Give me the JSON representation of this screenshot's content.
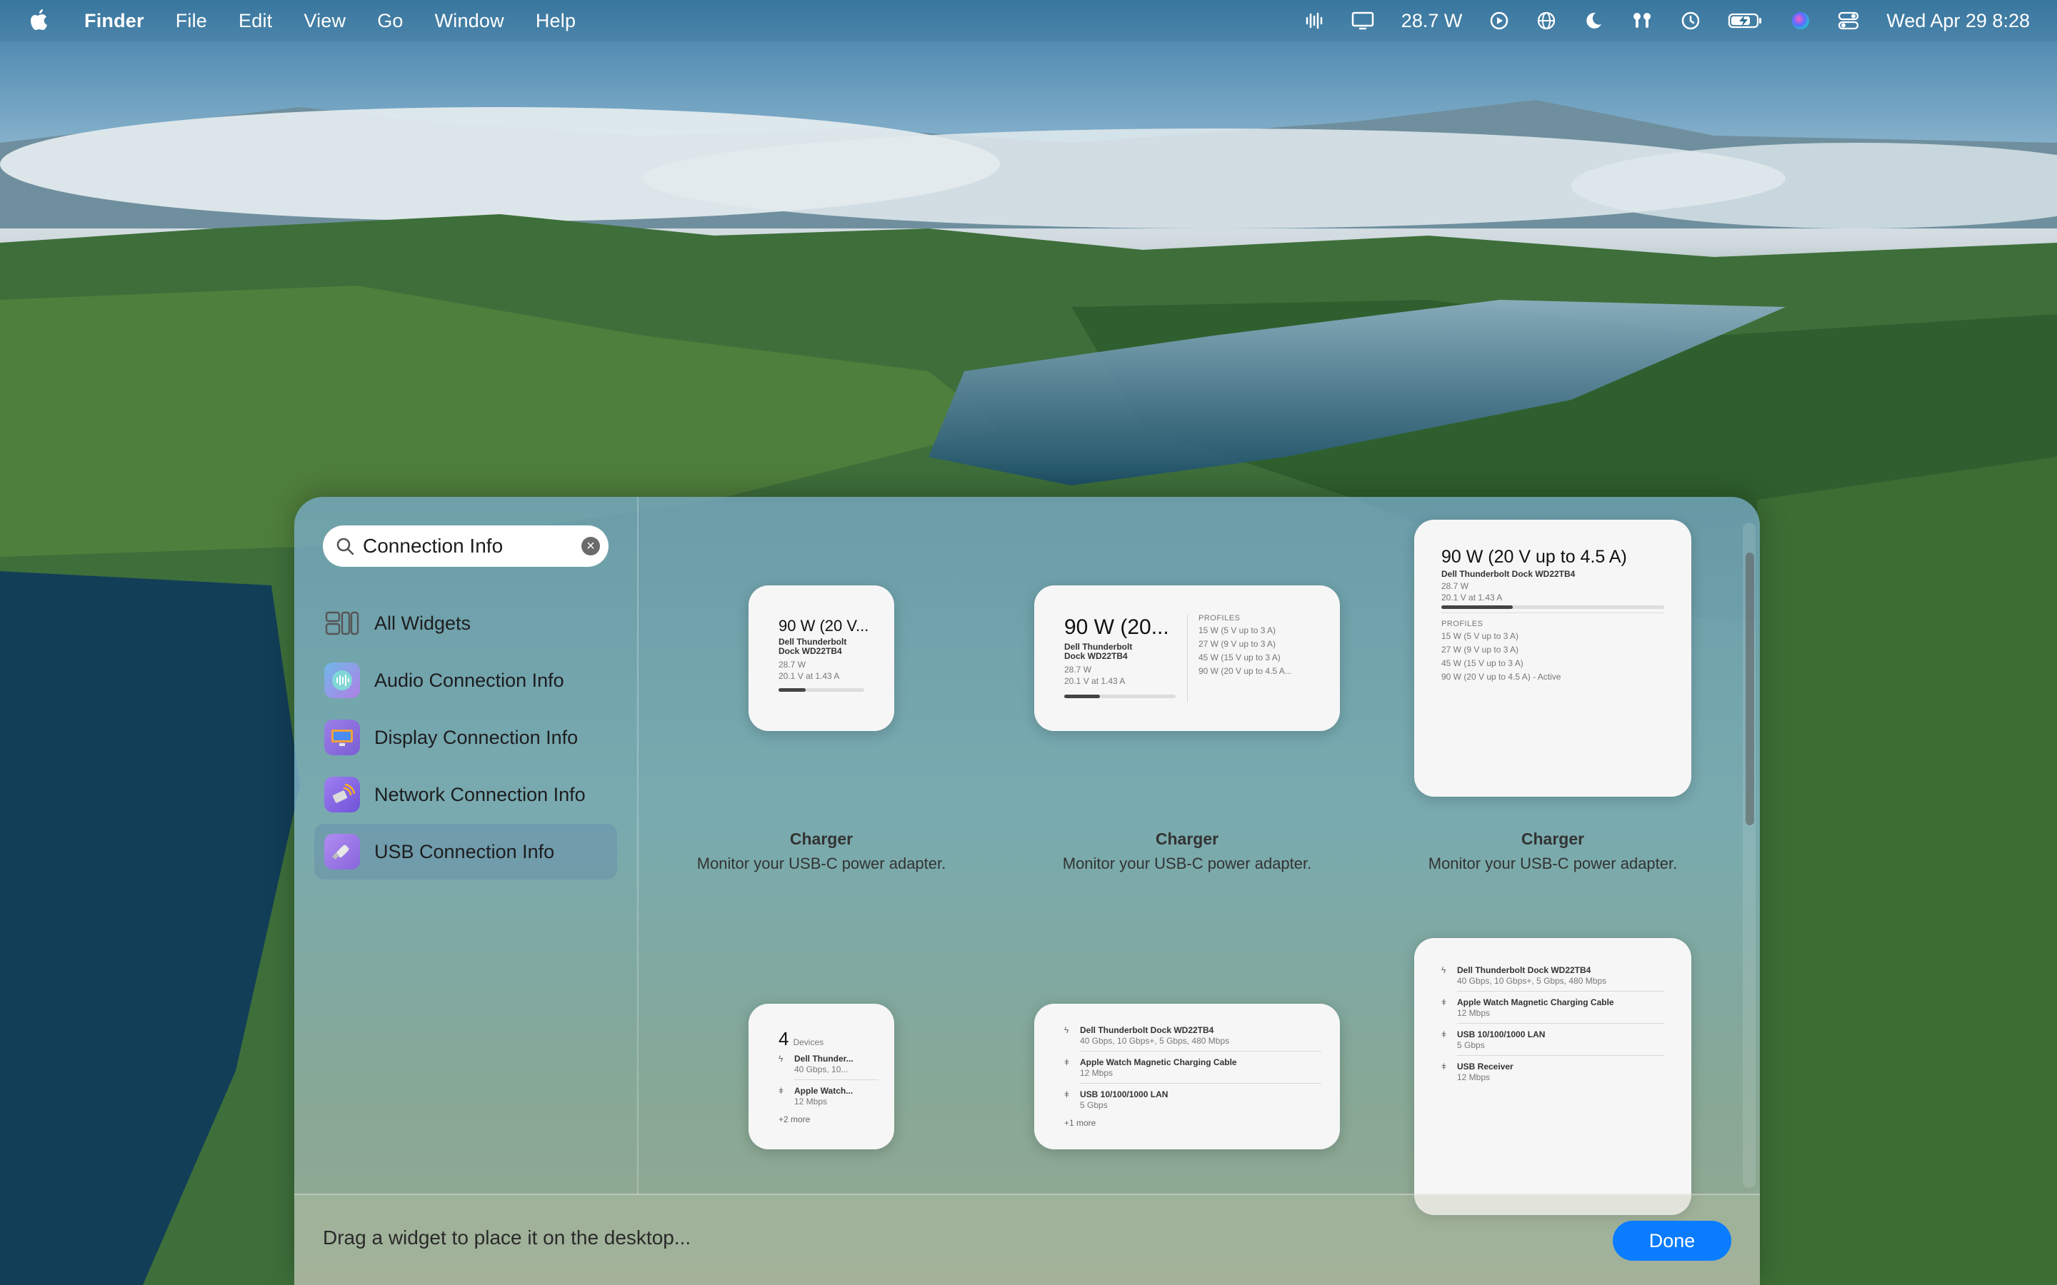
{
  "menubar": {
    "app_name": "Finder",
    "menus": [
      "File",
      "Edit",
      "View",
      "Go",
      "Window",
      "Help"
    ],
    "status": {
      "power_reading": "28.7 W",
      "datetime": "Wed Apr 29  8:28"
    }
  },
  "gallery": {
    "search": {
      "value": "Connection Info"
    },
    "sidebar": [
      {
        "label": "All Widgets",
        "icon": "widgets-grid-icon",
        "selected": false
      },
      {
        "label": "Audio Connection Info",
        "icon": "audio-app-icon",
        "selected": false
      },
      {
        "label": "Display Connection Info",
        "icon": "display-app-icon",
        "selected": false
      },
      {
        "label": "Network Connection Info",
        "icon": "network-app-icon",
        "selected": false
      },
      {
        "label": "USB Connection Info",
        "icon": "usb-app-icon",
        "selected": true
      }
    ],
    "charger": {
      "title": "90 W (20 V up to 4.5 A)",
      "title_small": "90 W (20 V...",
      "title_medium": "90 W (20...",
      "device": "Dell Thunderbolt Dock WD22TB4",
      "device_line1": "Dell Thunderbolt",
      "device_line2": "Dock WD22TB4",
      "watts": "28.7 W",
      "volts": "20.1 V at 1.43 A",
      "usage_fraction": 0.32,
      "profiles_heading": "PROFILES",
      "profiles": [
        "15 W (5 V up to 3 A)",
        "27 W (9 V up to 3 A)",
        "45 W (15 V up to 3 A)"
      ],
      "profile_last_medium": "90 W (20 V up to 4.5 A...",
      "profile_last_large": "90 W (20 V up to 4.5 A) - Active"
    },
    "captions": {
      "title": "Charger",
      "description": "Monitor your USB-C power adapter."
    },
    "devices": {
      "count": "4",
      "count_label": "Devices",
      "small": [
        {
          "name": "Dell Thunder...",
          "speed": "40 Gbps, 10..."
        },
        {
          "name": "Apple Watch...",
          "speed": "12 Mbps"
        }
      ],
      "small_more": "+2 more",
      "list": [
        {
          "name": "Dell Thunderbolt Dock WD22TB4",
          "speed": "40 Gbps, 10 Gbps+, 5 Gbps, 480 Mbps"
        },
        {
          "name": "Apple Watch Magnetic Charging Cable",
          "speed": "12 Mbps"
        },
        {
          "name": "USB 10/100/1000 LAN",
          "speed": "5 Gbps"
        },
        {
          "name": "USB Receiver",
          "speed": "12 Mbps"
        }
      ],
      "medium_more": "+1 more"
    },
    "footer": {
      "hint": "Drag a widget to place it on the desktop...",
      "done_label": "Done"
    }
  }
}
